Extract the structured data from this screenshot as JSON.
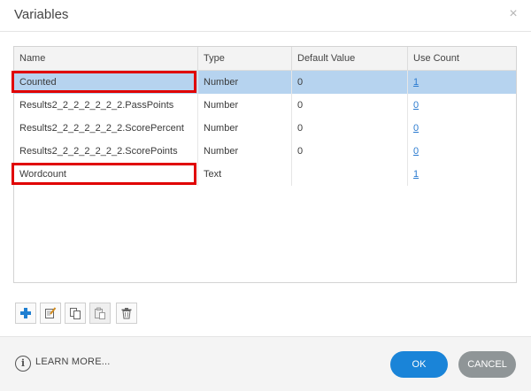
{
  "dialog": {
    "title": "Variables",
    "close_glyph": "×"
  },
  "table": {
    "columns": [
      "Name",
      "Type",
      "Default Value",
      "Use Count"
    ],
    "rows": [
      {
        "name": "Counted",
        "type": "Number",
        "default": "0",
        "use_count": "1",
        "selected": true,
        "highlighted": true
      },
      {
        "name": "Results2_2_2_2_2_2_2.PassPoints",
        "type": "Number",
        "default": "0",
        "use_count": "0",
        "selected": false,
        "highlighted": false
      },
      {
        "name": "Results2_2_2_2_2_2_2.ScorePercent",
        "type": "Number",
        "default": "0",
        "use_count": "0",
        "selected": false,
        "highlighted": false
      },
      {
        "name": "Results2_2_2_2_2_2_2.ScorePoints",
        "type": "Number",
        "default": "0",
        "use_count": "0",
        "selected": false,
        "highlighted": false
      },
      {
        "name": "Wordcount",
        "type": "Text",
        "default": "",
        "use_count": "1",
        "selected": false,
        "highlighted": true
      }
    ]
  },
  "toolbar": {
    "buttons": [
      {
        "icon": "add-icon"
      },
      {
        "icon": "edit-icon"
      },
      {
        "icon": "copy-icon"
      },
      {
        "icon": "paste-icon"
      },
      {
        "icon": "trash-icon"
      }
    ]
  },
  "footer": {
    "learn_more": "LEARN MORE...",
    "ok": "OK",
    "cancel": "CANCEL"
  },
  "colors": {
    "selected_row": "#b6d3ef",
    "highlight_box": "#e00000",
    "ok_button": "#1a84d8",
    "cancel_button": "#8f9597",
    "link": "#2b7bd0"
  }
}
